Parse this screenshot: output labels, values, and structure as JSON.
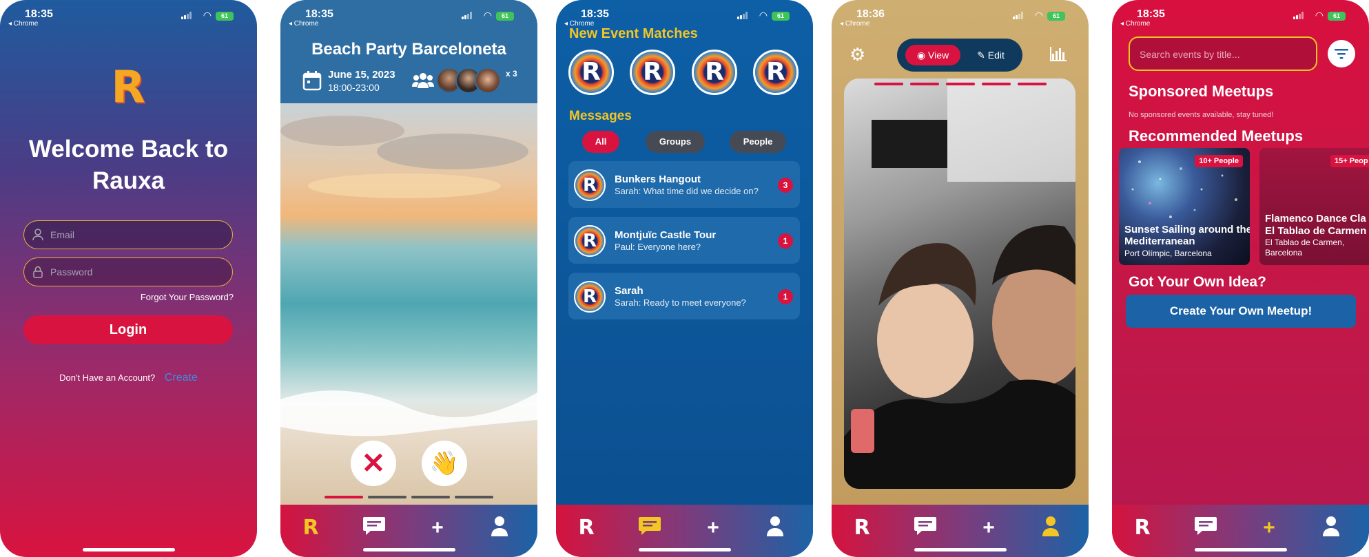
{
  "status": {
    "time_1": "18:35",
    "time_2": "18:35",
    "time_3": "18:35",
    "time_4": "18:36",
    "time_5": "18:35",
    "back_label": "◂ Chrome",
    "battery": "61"
  },
  "login": {
    "logo": "R",
    "title_line1": "Welcome Back to",
    "title_line2": "Rauxa",
    "email_placeholder": "Email",
    "password_placeholder": "Password",
    "forgot": "Forgot Your Password?",
    "login_button": "Login",
    "no_account": "Don't Have an Account?",
    "create_link": "Create"
  },
  "event": {
    "title": "Beach Party Barceloneta",
    "date": "June 15, 2023",
    "time": "18:00-23:00",
    "extra_count": "x 3",
    "reject_icon": "✕",
    "wave_icon": "👋"
  },
  "chat": {
    "matches_heading": "New Event Matches",
    "messages_heading": "Messages",
    "filters": [
      "All",
      "Groups",
      "People"
    ],
    "threads": [
      {
        "name": "Bunkers Hangout",
        "preview": "Sarah: What time did we decide on?",
        "unread": "3"
      },
      {
        "name": "Montjuïc Castle Tour",
        "preview": "Paul: Everyone here?",
        "unread": "1"
      },
      {
        "name": "Sarah",
        "preview": "Sarah: Ready to meet everyone?",
        "unread": "1"
      }
    ]
  },
  "profile": {
    "view_label": "View",
    "edit_label": "Edit"
  },
  "explore": {
    "search_placeholder": "Search events by title...",
    "sponsored_heading": "Sponsored Meetups",
    "sponsored_empty": "No sponsored events available, stay tuned!",
    "recommended_heading": "Recommended Meetups",
    "cards": [
      {
        "badge": "10+ People",
        "title": "Sunset Sailing around the Mediterranean",
        "location": "Port Olímpic, Barcelona"
      },
      {
        "badge": "15+ Peop",
        "title": "Flamenco Dance Cla El Tablao de Carmen",
        "location": "El Tablao de Carmen, Barcelona"
      }
    ],
    "idea_heading": "Got Your Own Idea?",
    "create_button": "Create Your Own Meetup!"
  },
  "colors": {
    "accent_red": "#d9133f",
    "gold": "#f3c623",
    "blue": "#0d5fa6"
  }
}
